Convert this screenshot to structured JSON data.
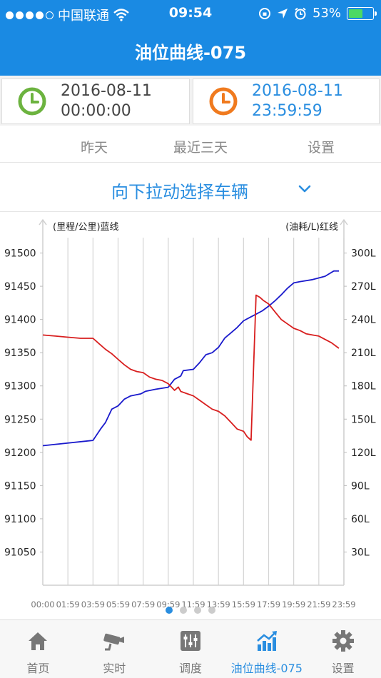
{
  "status_bar": {
    "carrier": "中国联通",
    "time": "09:54",
    "battery": "53%"
  },
  "nav": {
    "title": "油位曲线-075"
  },
  "date_range": {
    "start_date": "2016-08-11",
    "start_time": "00:00:00",
    "end_date": "2016-08-11",
    "end_time": "23:59:59"
  },
  "filters": {
    "yesterday": "昨天",
    "last_three_days": "最近三天",
    "settings": "设置"
  },
  "vehicle_selector": {
    "label": "向下拉动选择车辆"
  },
  "pager": {
    "count": 4,
    "active": 0
  },
  "tabs": [
    {
      "label": "首页",
      "icon": "home-icon"
    },
    {
      "label": "实时",
      "icon": "camera-icon"
    },
    {
      "label": "调度",
      "icon": "sliders-icon"
    },
    {
      "label": "油位曲线-075",
      "icon": "chart-icon",
      "active": true
    },
    {
      "label": "设置",
      "icon": "gear-icon"
    }
  ],
  "colors": {
    "brand": "#1a8ae3",
    "mileage_line": "#1a1acc",
    "fuel_line": "#d81e1e",
    "accent_text": "#2a8ee0",
    "clock_start": "#6cb33f",
    "clock_end": "#f07a1e"
  },
  "chart_data": {
    "type": "line",
    "left_axis_label": "(里程/公里)蓝线",
    "right_axis_label": "(油耗/L)红线",
    "x_tick_labels": [
      "00:00",
      "01:59",
      "03:59",
      "05:59",
      "07:59",
      "09:59",
      "11:59",
      "13:59",
      "15:59",
      "17:59",
      "19:59",
      "21:59",
      "23:59"
    ],
    "left_ticks": [
      91500,
      91450,
      91400,
      91350,
      91300,
      91250,
      91200,
      91150,
      91100,
      91050
    ],
    "right_ticks": [
      "300L",
      "270L",
      "240L",
      "210L",
      "180L",
      "150L",
      "120L",
      "90L",
      "60L",
      "30L"
    ],
    "left_range": [
      91000,
      91550
    ],
    "right_range": [
      0,
      330
    ],
    "x_range": [
      0,
      24
    ],
    "series": [
      {
        "name": "蓝线",
        "axis": "left",
        "points": [
          [
            0,
            91210
          ],
          [
            4.0,
            91218
          ],
          [
            4.6,
            91235
          ],
          [
            5.0,
            91245
          ],
          [
            5.5,
            91265
          ],
          [
            6.0,
            91270
          ],
          [
            6.5,
            91280
          ],
          [
            7.0,
            91285
          ],
          [
            7.8,
            91288
          ],
          [
            8.2,
            91292
          ],
          [
            9.0,
            91295
          ],
          [
            10.0,
            91298
          ],
          [
            10.5,
            91310
          ],
          [
            11.0,
            91315
          ],
          [
            11.2,
            91323
          ],
          [
            12.0,
            91325
          ],
          [
            12.5,
            91335
          ],
          [
            13.0,
            91347
          ],
          [
            13.5,
            91350
          ],
          [
            14.0,
            91358
          ],
          [
            14.5,
            91372
          ],
          [
            15.0,
            91380
          ],
          [
            15.5,
            91388
          ],
          [
            16.0,
            91398
          ],
          [
            16.5,
            91403
          ],
          [
            17.0,
            91408
          ],
          [
            17.5,
            91413
          ],
          [
            18.0,
            91420
          ],
          [
            18.5,
            91428
          ],
          [
            19.0,
            91437
          ],
          [
            19.5,
            91447
          ],
          [
            20.0,
            91455
          ],
          [
            20.5,
            91457
          ],
          [
            21.5,
            91460
          ],
          [
            22.5,
            91465
          ],
          [
            23.2,
            91473
          ],
          [
            23.6,
            91473
          ]
        ]
      },
      {
        "name": "红线",
        "axis": "right",
        "points": [
          [
            0,
            226
          ],
          [
            1.0,
            225
          ],
          [
            2.0,
            224
          ],
          [
            3.0,
            223
          ],
          [
            4.0,
            223
          ],
          [
            4.5,
            218
          ],
          [
            5.0,
            213
          ],
          [
            5.5,
            209
          ],
          [
            6.0,
            204
          ],
          [
            6.5,
            199
          ],
          [
            7.0,
            195
          ],
          [
            7.5,
            193
          ],
          [
            8.0,
            192
          ],
          [
            8.5,
            188
          ],
          [
            9.0,
            186
          ],
          [
            9.5,
            185
          ],
          [
            10.0,
            182
          ],
          [
            10.5,
            176
          ],
          [
            10.8,
            179
          ],
          [
            11.0,
            175
          ],
          [
            11.5,
            173
          ],
          [
            12.0,
            171
          ],
          [
            12.5,
            167
          ],
          [
            13.0,
            163
          ],
          [
            13.5,
            159
          ],
          [
            14.0,
            157
          ],
          [
            14.5,
            153
          ],
          [
            15.0,
            147
          ],
          [
            15.5,
            141
          ],
          [
            16.0,
            139
          ],
          [
            16.3,
            134
          ],
          [
            16.6,
            131
          ],
          [
            17.0,
            262
          ],
          [
            17.3,
            260
          ],
          [
            17.6,
            257
          ],
          [
            18.0,
            254
          ],
          [
            18.5,
            247
          ],
          [
            19.0,
            240
          ],
          [
            19.5,
            236
          ],
          [
            20.0,
            232
          ],
          [
            20.5,
            230
          ],
          [
            21.0,
            227
          ],
          [
            21.5,
            226
          ],
          [
            22.0,
            225
          ],
          [
            22.5,
            222
          ],
          [
            23.0,
            219
          ],
          [
            23.6,
            214
          ]
        ]
      }
    ]
  }
}
